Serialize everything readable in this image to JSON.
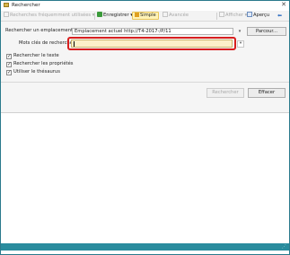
{
  "window": {
    "title": "Rechercher"
  },
  "toolbar": {
    "frequent_searches": "Recherches fréquemment utilisées",
    "save": "Enregistrer",
    "simple": "Simple",
    "advanced": "Avancée",
    "display": "Afficher",
    "preview": "Aperçu"
  },
  "form": {
    "location_label": "Rechercher un emplacement :",
    "location_value": "Emplacement actuel http://T4-2017-/P/11",
    "browse_button": "Parcour...",
    "keywords_label": "Mots clés de recherche",
    "keywords_value": "",
    "checkboxes": [
      {
        "label": "Rechercher le texte",
        "checked": true
      },
      {
        "label": "Rechercher les propriétés",
        "checked": true
      },
      {
        "label": "Utiliser le thésaurus",
        "checked": true
      }
    ],
    "search_button": "Rechercher",
    "clear_button": "Effacer"
  },
  "colors": {
    "accent": "#2a8c9e",
    "highlight_border": "#d81e1e",
    "keywords_background": "#fdf0c8",
    "simple_background": "#fff3b6"
  }
}
